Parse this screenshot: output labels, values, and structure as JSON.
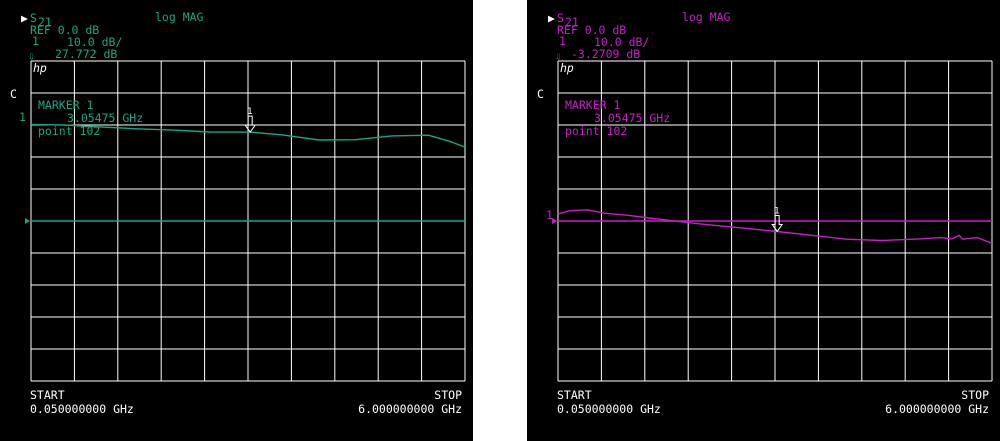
{
  "colors": {
    "screen_bg": "#000000",
    "grid": "#ffffff",
    "text_white": "#ffffff",
    "left_trace": "#14a884",
    "right_trace": "#c71fc7"
  },
  "screens": [
    {
      "header": {
        "param": "S",
        "param_sub": "21",
        "format": "log MAG",
        "ref": "REF 0.0 dB",
        "scale": "10.0 dB/",
        "marker_value": "27.772 dB",
        "port": "1",
        "hp": "hp"
      },
      "channel": "C",
      "marker": {
        "title": "MARKER 1",
        "freq": "3.05475 GHz",
        "point": "point 102",
        "label": "1"
      },
      "ref_label": "1",
      "footer": {
        "start_label": "START",
        "start_value": "0.050000000 GHz",
        "stop_label": "STOP",
        "stop_value": "6.000000000 GHz"
      },
      "chart_data": {
        "type": "line",
        "x": [
          0.05,
          0.5,
          1.0,
          1.5,
          2.0,
          2.5,
          3.05475,
          3.5,
          4.0,
          4.5,
          5.0,
          5.5,
          5.8,
          6.0
        ],
        "values": [
          30.2,
          30.0,
          29.4,
          28.8,
          28.4,
          27.8,
          27.772,
          26.9,
          25.3,
          25.4,
          26.6,
          26.8,
          24.8,
          23.1
        ],
        "ylim": [
          -50,
          50
        ],
        "xlim": [
          0.05,
          6.0
        ],
        "reference_level": 0,
        "marker_x": 3.05475,
        "grid": true
      }
    },
    {
      "header": {
        "param": "S",
        "param_sub": "21",
        "format": "log MAG",
        "ref": "REF 0.0 dB",
        "scale": "10.0 dB/",
        "marker_value": "-3.2709 dB",
        "port": "1",
        "hp": "hp"
      },
      "channel": "C",
      "marker": {
        "title": "MARKER 1",
        "freq": "3.05475 GHz",
        "point": "point 102",
        "label": "1"
      },
      "ref_label": "1",
      "footer": {
        "start_label": "START",
        "start_value": "0.050000000 GHz",
        "stop_label": "STOP",
        "stop_value": "6.000000000 GHz"
      },
      "chart_data": {
        "type": "line",
        "x": [
          0.05,
          0.2,
          0.45,
          0.7,
          1.0,
          1.5,
          2.0,
          2.5,
          3.05475,
          3.5,
          4.0,
          4.5,
          5.0,
          5.3,
          5.45,
          5.55,
          5.6,
          5.8,
          6.0
        ],
        "values": [
          2.2,
          3.2,
          3.5,
          2.4,
          1.8,
          0.4,
          -0.9,
          -2.0,
          -3.2709,
          -4.4,
          -5.7,
          -6.1,
          -5.6,
          -5.2,
          -5.6,
          -4.5,
          -5.7,
          -5.2,
          -7.0
        ],
        "ylim": [
          -50,
          50
        ],
        "xlim": [
          0.05,
          6.0
        ],
        "reference_level": 0,
        "marker_x": 3.05475,
        "grid": true
      }
    }
  ]
}
